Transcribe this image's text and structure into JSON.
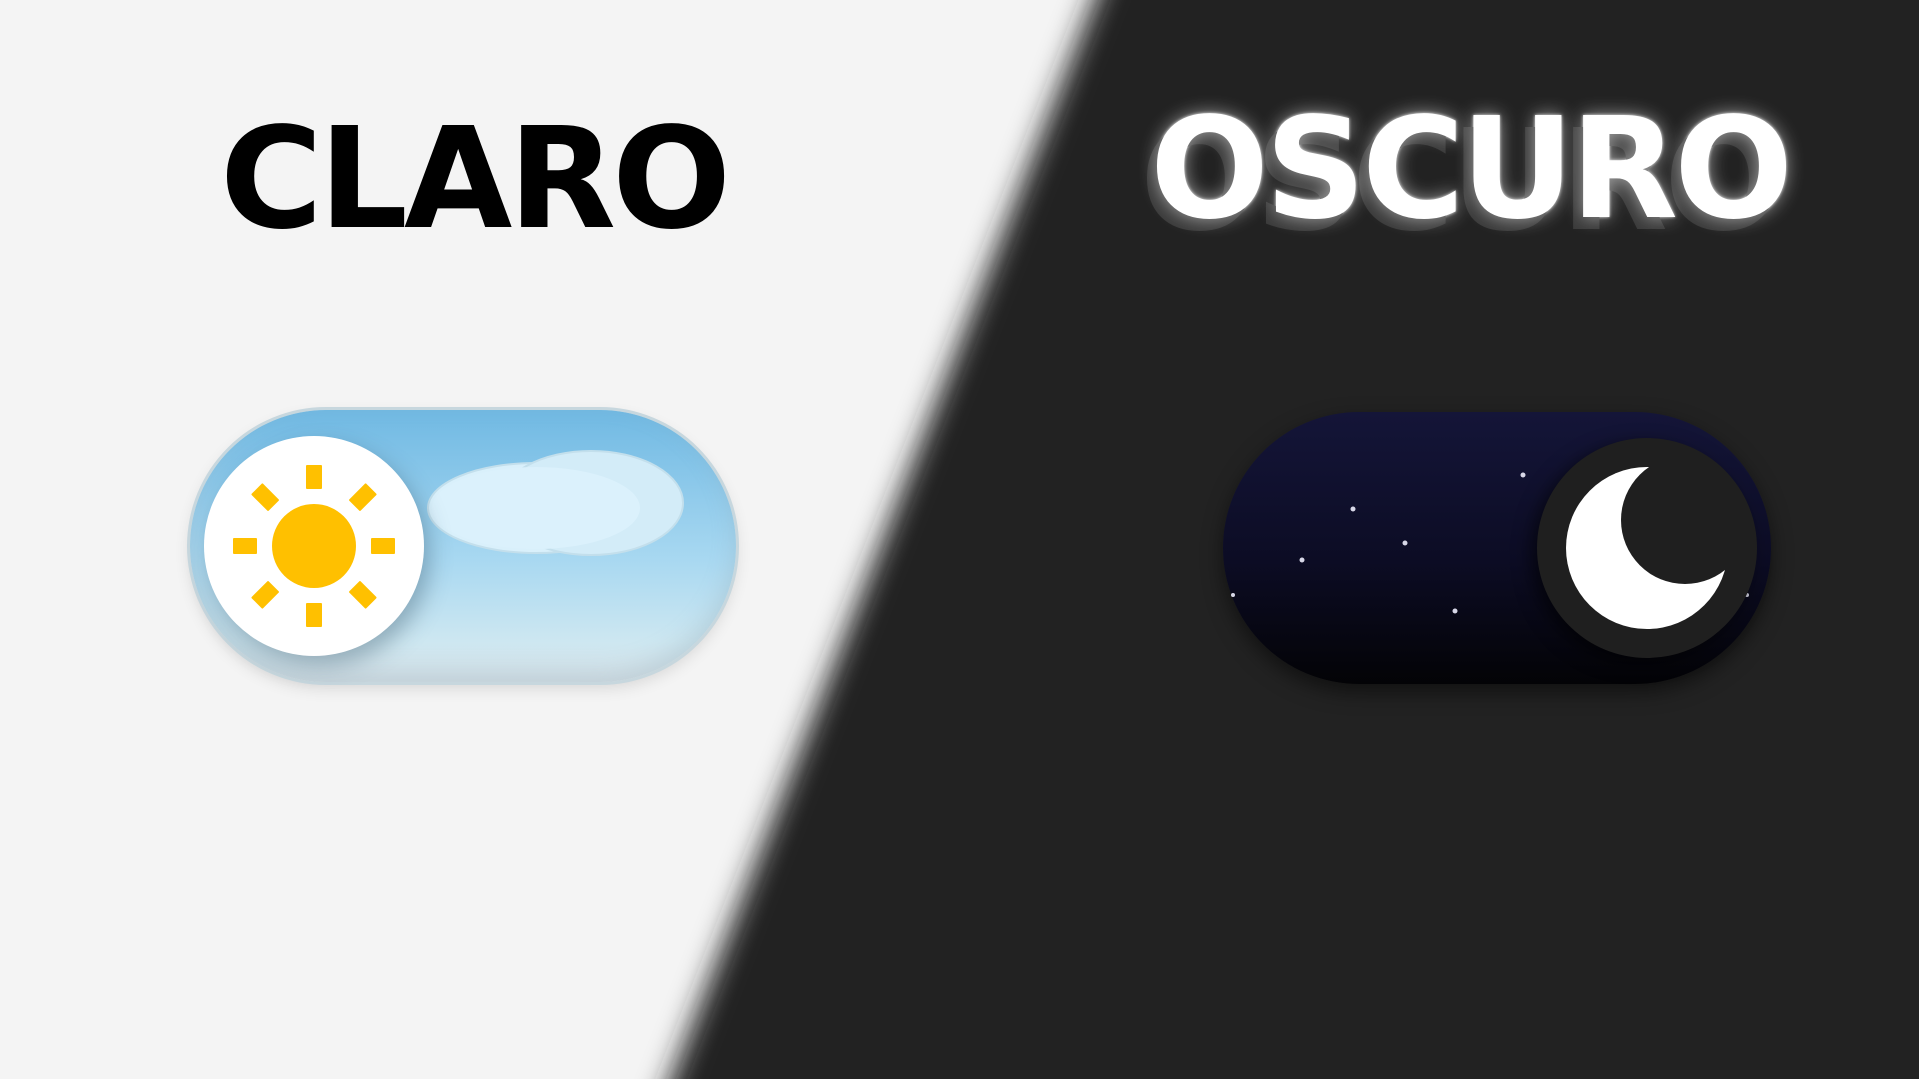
{
  "light_panel": {
    "title": "CLARO",
    "background_color": "#f4f4f4",
    "toggle": {
      "state": "light",
      "knob_icon": "sun-icon",
      "decoration_icon": "cloud-icon",
      "sun_color": "#ffc000",
      "sky_color_top": "#70b9e3",
      "sky_color_bottom": "#d8e4ea"
    }
  },
  "dark_panel": {
    "title": "OSCURO",
    "background_color": "#202020",
    "toggle": {
      "state": "dark",
      "knob_icon": "moon-icon",
      "decoration_icon": "stars-icon",
      "moon_color": "#ffffff",
      "night_color_top": "#141538",
      "night_color_bottom": "#030306"
    }
  }
}
